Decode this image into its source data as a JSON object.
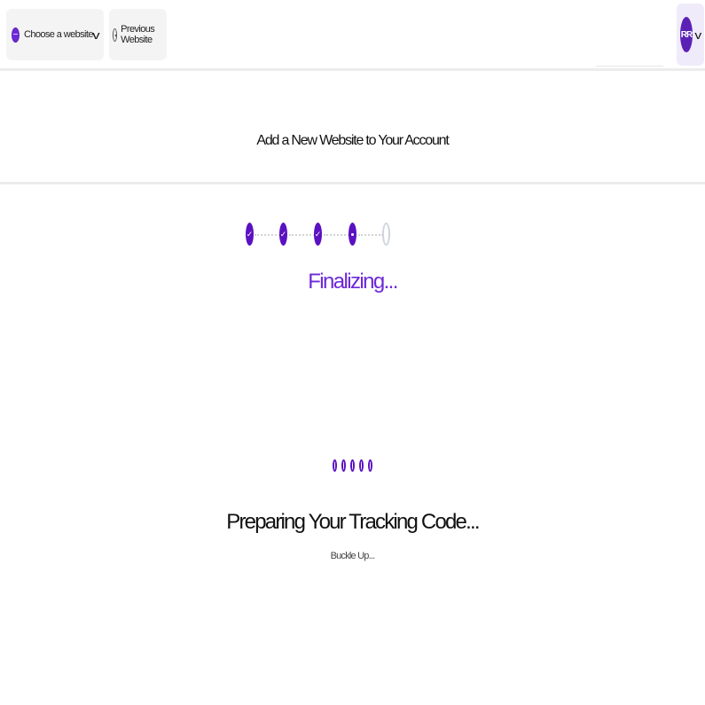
{
  "header": {
    "site_selector": {
      "label": "Choose a website",
      "icon": "globe-icon"
    },
    "previous_website": {
      "label": "Previous Website",
      "icon": "back-circle-icon"
    },
    "user": {
      "initials": "RR"
    }
  },
  "page_title": "Add a New Website to Your Account",
  "stepper": {
    "steps": [
      {
        "state": "completed",
        "symbol": "✓"
      },
      {
        "state": "completed",
        "symbol": "✓"
      },
      {
        "state": "completed",
        "symbol": "✓"
      },
      {
        "state": "current",
        "symbol": ""
      },
      {
        "state": "pending",
        "symbol": ""
      }
    ]
  },
  "status_text": "Finalizing...",
  "loading": {
    "title": "Preparing Your Tracking Code...",
    "subtitle": "Buckle Up..."
  },
  "colors": {
    "accent": "#6d28d9",
    "step": "#5b11c2",
    "pending": "#cfd3e0"
  }
}
